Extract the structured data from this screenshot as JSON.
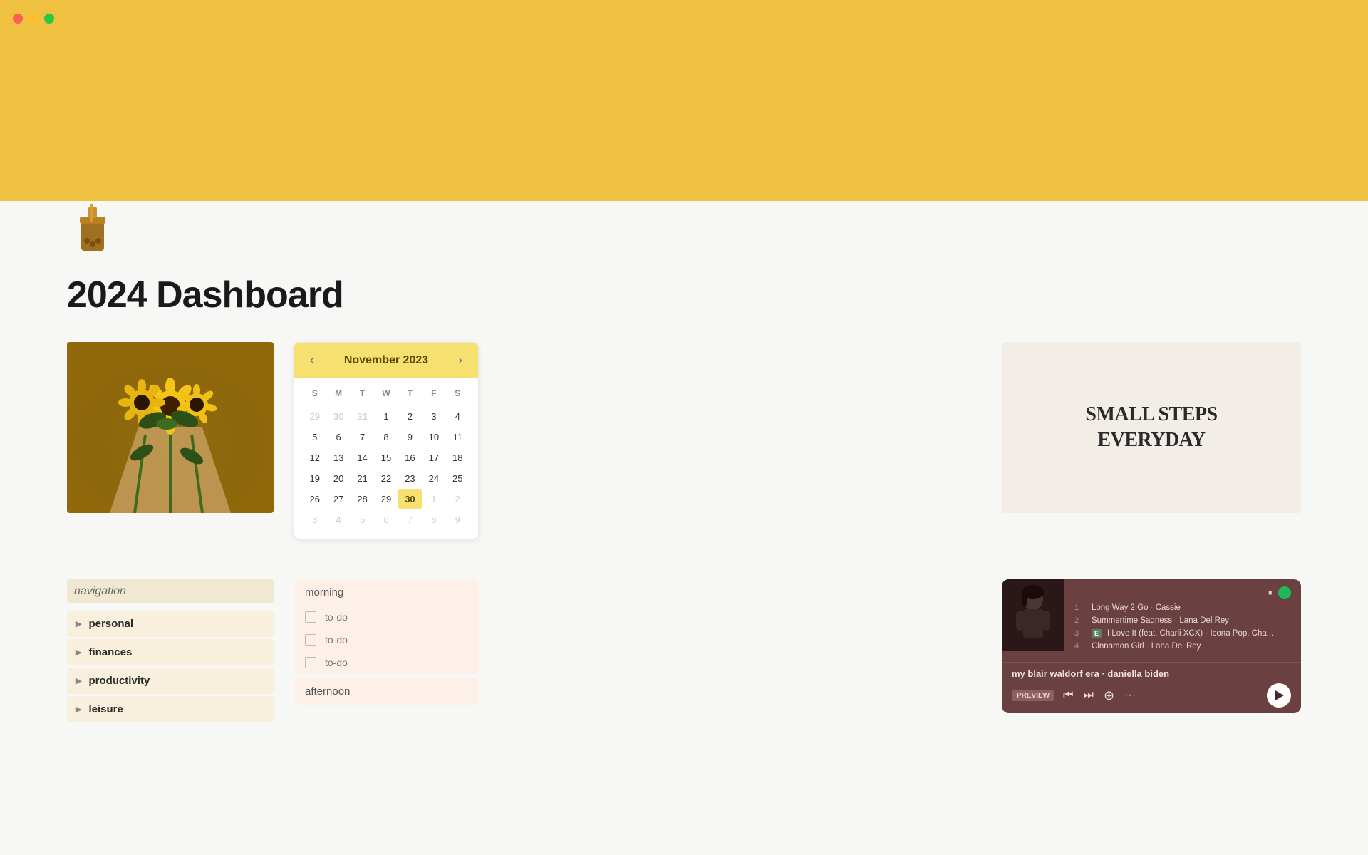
{
  "titlebar": {
    "traffic_lights": [
      "red",
      "yellow",
      "green"
    ]
  },
  "page": {
    "icon": "🧋",
    "title": "2024  Dashboard"
  },
  "calendar": {
    "month": "November 2023",
    "days_header": [
      "S",
      "M",
      "T",
      "W",
      "T",
      "F",
      "S"
    ],
    "prev_label": "‹",
    "next_label": "›",
    "weeks": [
      [
        "29",
        "30",
        "31",
        "1",
        "2",
        "3",
        "4"
      ],
      [
        "5",
        "6",
        "7",
        "8",
        "9",
        "10",
        "11"
      ],
      [
        "12",
        "13",
        "14",
        "15",
        "16",
        "17",
        "18"
      ],
      [
        "19",
        "20",
        "21",
        "22",
        "23",
        "24",
        "25"
      ],
      [
        "26",
        "27",
        "28",
        "29",
        "30",
        "1",
        "2"
      ],
      [
        "3",
        "4",
        "5",
        "6",
        "7",
        "8",
        "9"
      ]
    ],
    "other_month_days": [
      "29",
      "30",
      "31",
      "1",
      "2",
      "3",
      "4",
      "9"
    ],
    "today": "30"
  },
  "quote": {
    "line1": "SMALL STEPS",
    "line2": "EVERYDAY"
  },
  "music": {
    "tracks": [
      {
        "num": "1",
        "title": "Long Way 2 Go",
        "artist": "Cassie",
        "badge": null
      },
      {
        "num": "2",
        "title": "Summertime Sadness",
        "artist": "Lana Del Rey",
        "badge": null
      },
      {
        "num": "3",
        "title": "I Love It (feat. Charli XCX)",
        "artist": "Icona Pop, Cha...",
        "badge": "E"
      },
      {
        "num": "4",
        "title": "Cinnamon Girl",
        "artist": "Lana Del Rey",
        "badge": null
      }
    ],
    "playlist_name": "my blair waldorf era · daniella biden",
    "preview_label": "PREVIEW",
    "controls": {
      "skip_back": "⏮",
      "skip_forward": "⏭",
      "add": "⊕",
      "more": "···"
    }
  },
  "navigation": {
    "title": "navigation",
    "items": [
      {
        "label": "personal",
        "arrow": "▶"
      },
      {
        "label": "finances",
        "arrow": "▶"
      },
      {
        "label": "productivity",
        "arrow": "▶"
      },
      {
        "label": "leisure",
        "arrow": "▶"
      }
    ]
  },
  "todo": {
    "sections": [
      {
        "header": "morning",
        "items": [
          "to-do",
          "to-do",
          "to-do"
        ]
      },
      {
        "header": "afternoon",
        "items": []
      }
    ]
  }
}
